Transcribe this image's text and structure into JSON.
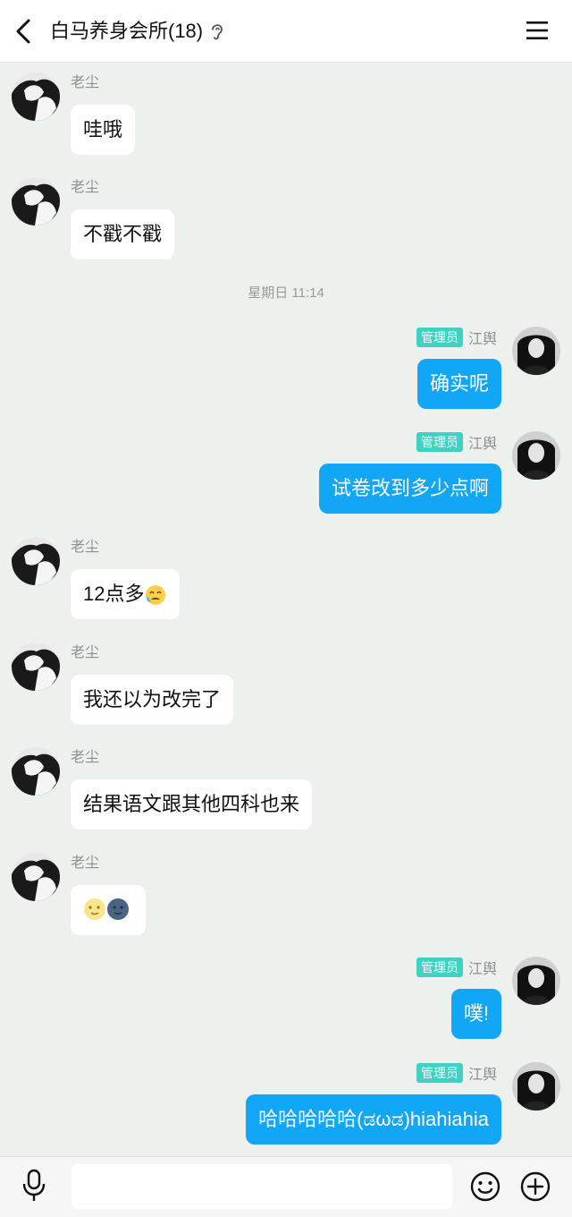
{
  "header": {
    "title": "白马养身会所(18)"
  },
  "timestamp": "星期日 11:14",
  "messages": [
    {
      "side": "in",
      "name": "老尘",
      "text": "哇哦"
    },
    {
      "side": "in",
      "name": "老尘",
      "text": "不戳不戳"
    },
    {
      "side": "out",
      "badge": "管理员",
      "name": "江舆",
      "text": "确实呢"
    },
    {
      "side": "out",
      "badge": "管理员",
      "name": "江舆",
      "text": "试卷改到多少点啊"
    },
    {
      "side": "in",
      "name": "老尘",
      "text": "12点多"
    },
    {
      "side": "in",
      "name": "老尘",
      "text": "我还以为改完了"
    },
    {
      "side": "in",
      "name": "老尘",
      "text": "结果语文跟其他四科也来"
    },
    {
      "side": "in",
      "name": "老尘",
      "text": ""
    },
    {
      "side": "out",
      "badge": "管理员",
      "name": "江舆",
      "text": "噗!"
    },
    {
      "side": "out",
      "badge": "管理员",
      "name": "江舆",
      "text": "哈哈哈哈哈(ಡωಡ)hiahiahia"
    }
  ],
  "colors": {
    "outgoing_bubble": "#12a6f6",
    "admin_badge": "#3dd2c4",
    "background": "#edf1ed"
  },
  "icons": {
    "back": "chevron-left-icon",
    "listen": "ear-icon",
    "menu": "hamburger-menu-icon",
    "mic": "microphone-icon",
    "emoji": "smiley-icon",
    "add": "plus-circle-icon"
  },
  "input": {
    "placeholder": "",
    "value": ""
  }
}
